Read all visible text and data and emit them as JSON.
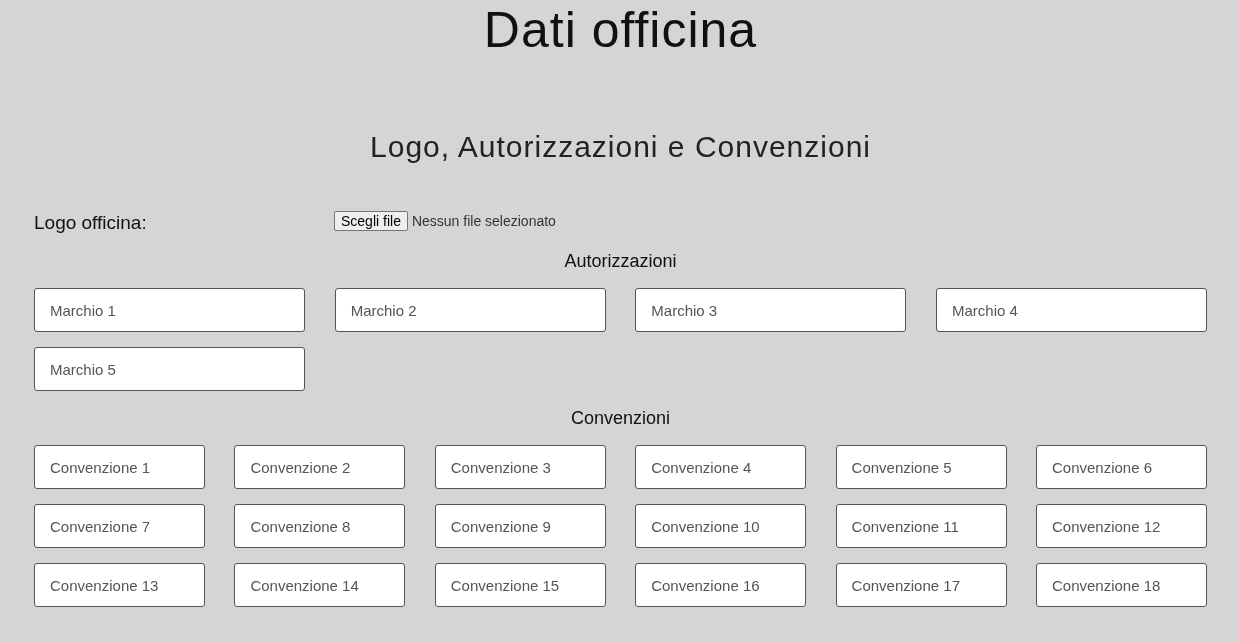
{
  "page_title": "Dati officina",
  "section_title": "Logo, Autorizzazioni e Convenzioni",
  "logo": {
    "label": "Logo officina:",
    "button": "Scegli file",
    "status": "Nessun file selezionato"
  },
  "autorizzazioni": {
    "heading": "Autorizzazioni",
    "fields": [
      {
        "placeholder": "Marchio 1"
      },
      {
        "placeholder": "Marchio 2"
      },
      {
        "placeholder": "Marchio 3"
      },
      {
        "placeholder": "Marchio 4"
      },
      {
        "placeholder": "Marchio 5"
      }
    ]
  },
  "convenzioni": {
    "heading": "Convenzioni",
    "fields": [
      {
        "placeholder": "Convenzione 1"
      },
      {
        "placeholder": "Convenzione 2"
      },
      {
        "placeholder": "Convenzione 3"
      },
      {
        "placeholder": "Convenzione 4"
      },
      {
        "placeholder": "Convenzione 5"
      },
      {
        "placeholder": "Convenzione 6"
      },
      {
        "placeholder": "Convenzione 7"
      },
      {
        "placeholder": "Convenzione 8"
      },
      {
        "placeholder": "Convenzione 9"
      },
      {
        "placeholder": "Convenzione 10"
      },
      {
        "placeholder": "Convenzione 11"
      },
      {
        "placeholder": "Convenzione 12"
      },
      {
        "placeholder": "Convenzione 13"
      },
      {
        "placeholder": "Convenzione 14"
      },
      {
        "placeholder": "Convenzione 15"
      },
      {
        "placeholder": "Convenzione 16"
      },
      {
        "placeholder": "Convenzione 17"
      },
      {
        "placeholder": "Convenzione 18"
      }
    ]
  }
}
